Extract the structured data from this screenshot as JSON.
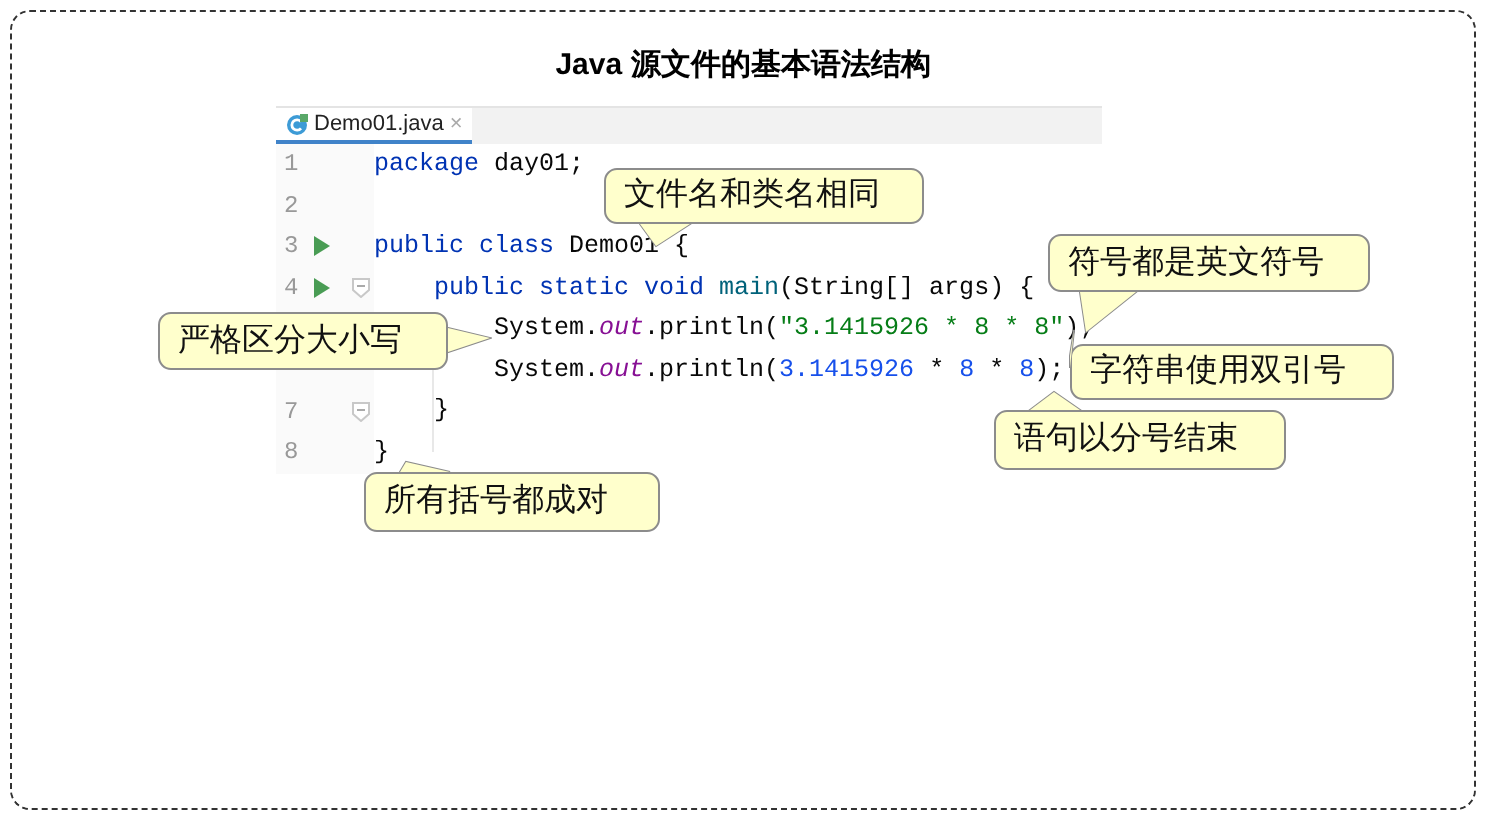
{
  "title": "Java 源文件的基本语法结构",
  "editor": {
    "tab": {
      "label": "Demo01.java",
      "close": "×"
    },
    "lines": [
      {
        "number": "1",
        "run": false,
        "fold": false,
        "tokens": [
          {
            "text": "package",
            "kind": "keyword"
          },
          {
            "text": " day01;",
            "kind": "plain"
          }
        ]
      },
      {
        "number": "2",
        "run": false,
        "fold": false
      },
      {
        "number": "3",
        "run": true,
        "fold": false,
        "tokens": [
          {
            "text": "public class",
            "kind": "keyword"
          },
          {
            "text": " Demo01 {",
            "kind": "plain"
          }
        ],
        "children": [
          {
            "number": "4",
            "run": true,
            "fold": true,
            "tokens": [
              {
                "text": "public static void ",
                "kind": "keyword"
              },
              {
                "text": "main",
                "kind": "method"
              },
              {
                "text": "(String[] args) {",
                "kind": "plain"
              }
            ],
            "children": [
              {
                "tokens": [
                  {
                    "text": "System.",
                    "kind": "plain"
                  },
                  {
                    "text": "out",
                    "kind": "field"
                  },
                  {
                    "text": ".println(",
                    "kind": "plain"
                  },
                  {
                    "text": "\"3.1415926 * 8 * 8\"",
                    "kind": "string"
                  },
                  {
                    "text": ");",
                    "kind": "plain"
                  }
                ]
              },
              {
                "tokens": [
                  {
                    "text": "System.",
                    "kind": "plain"
                  },
                  {
                    "text": "out",
                    "kind": "field"
                  },
                  {
                    "text": ".println(",
                    "kind": "plain"
                  },
                  {
                    "text": "3.1415926",
                    "kind": "number"
                  },
                  {
                    "text": " * ",
                    "kind": "plain"
                  },
                  {
                    "text": "8",
                    "kind": "number"
                  },
                  {
                    "text": " * ",
                    "kind": "plain"
                  },
                  {
                    "text": "8",
                    "kind": "number"
                  },
                  {
                    "text": ");",
                    "kind": "plain"
                  }
                ]
              }
            ]
          },
          {
            "number": "7",
            "run": false,
            "fold": true,
            "tokens": [
              {
                "text": "}",
                "kind": "plain"
              }
            ]
          }
        ]
      },
      {
        "number": "8",
        "run": false,
        "fold": false,
        "tokens": [
          {
            "text": "}",
            "kind": "plain"
          }
        ]
      }
    ]
  },
  "callouts": [
    {
      "text": "文件名和类名相同"
    },
    {
      "text": "符号都是英文符号"
    },
    {
      "text": "字符串使用双引号"
    },
    {
      "text": "严格区分大小写"
    },
    {
      "text": "语句以分号结束"
    },
    {
      "text": "所有括号都成对"
    }
  ]
}
